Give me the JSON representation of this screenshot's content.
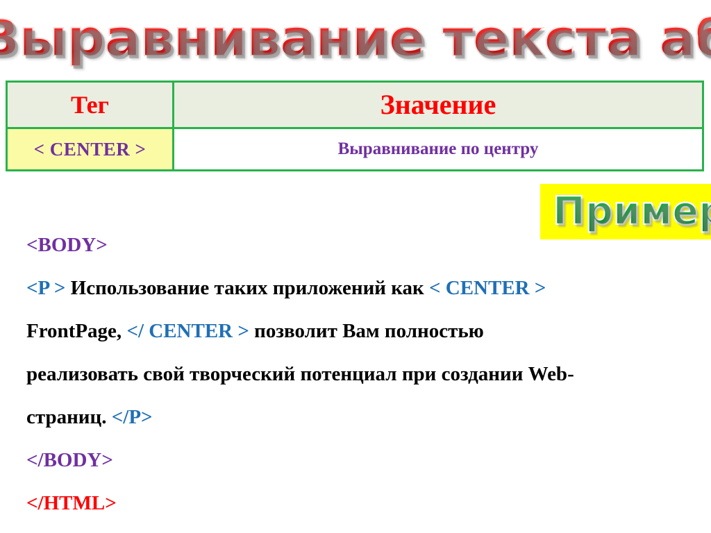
{
  "slide": {
    "title": "Выравнивание текста абзаца",
    "title_color": "#E01B1B",
    "background": "#FFFFFF"
  },
  "table": {
    "border_color": "#29B24C",
    "header_bg": "#EAEEE0",
    "header_text_color": "#FF0000",
    "tag_cell_bg": "#FBFBA6",
    "value_cell_bg": "#FFFFFF",
    "cell_text_color": "#7030A0",
    "headers": [
      "Тег",
      "Значение"
    ],
    "rows": [
      {
        "tag": "< CENTER >",
        "value": "Выравнивание по центру"
      }
    ]
  },
  "example_badge": {
    "label": "Пример",
    "text_color": "#199E3F",
    "background": "#FFFF00"
  },
  "code": {
    "colors": {
      "purple": "#7030A0",
      "blue": "#1F6FB5",
      "red": "#FF0000",
      "black": "#000000"
    },
    "lines": [
      {
        "parts": [
          {
            "text": "<BODY>",
            "color": "purple"
          }
        ]
      },
      {
        "parts": [
          {
            "text": "<P >",
            "color": "blue"
          },
          {
            "text": " Использование таких приложений как ",
            "color": "black"
          },
          {
            "text": "< CENTER >",
            "color": "blue"
          }
        ]
      },
      {
        "parts": [
          {
            "text": "FrontPage, ",
            "color": "black"
          },
          {
            "text": "</ CENTER >",
            "color": "blue"
          },
          {
            "text": " позволит Вам полностью",
            "color": "black"
          }
        ]
      },
      {
        "parts": [
          {
            "text": "реализовать свой творческий потенциал при создании Web-",
            "color": "black"
          }
        ]
      },
      {
        "parts": [
          {
            "text": "страниц. ",
            "color": "black"
          },
          {
            "text": "</P>",
            "color": "blue"
          }
        ]
      },
      {
        "parts": [
          {
            "text": "</BODY>",
            "color": "purple"
          }
        ]
      },
      {
        "parts": [
          {
            "text": "</HTML>",
            "color": "red"
          }
        ]
      }
    ]
  }
}
